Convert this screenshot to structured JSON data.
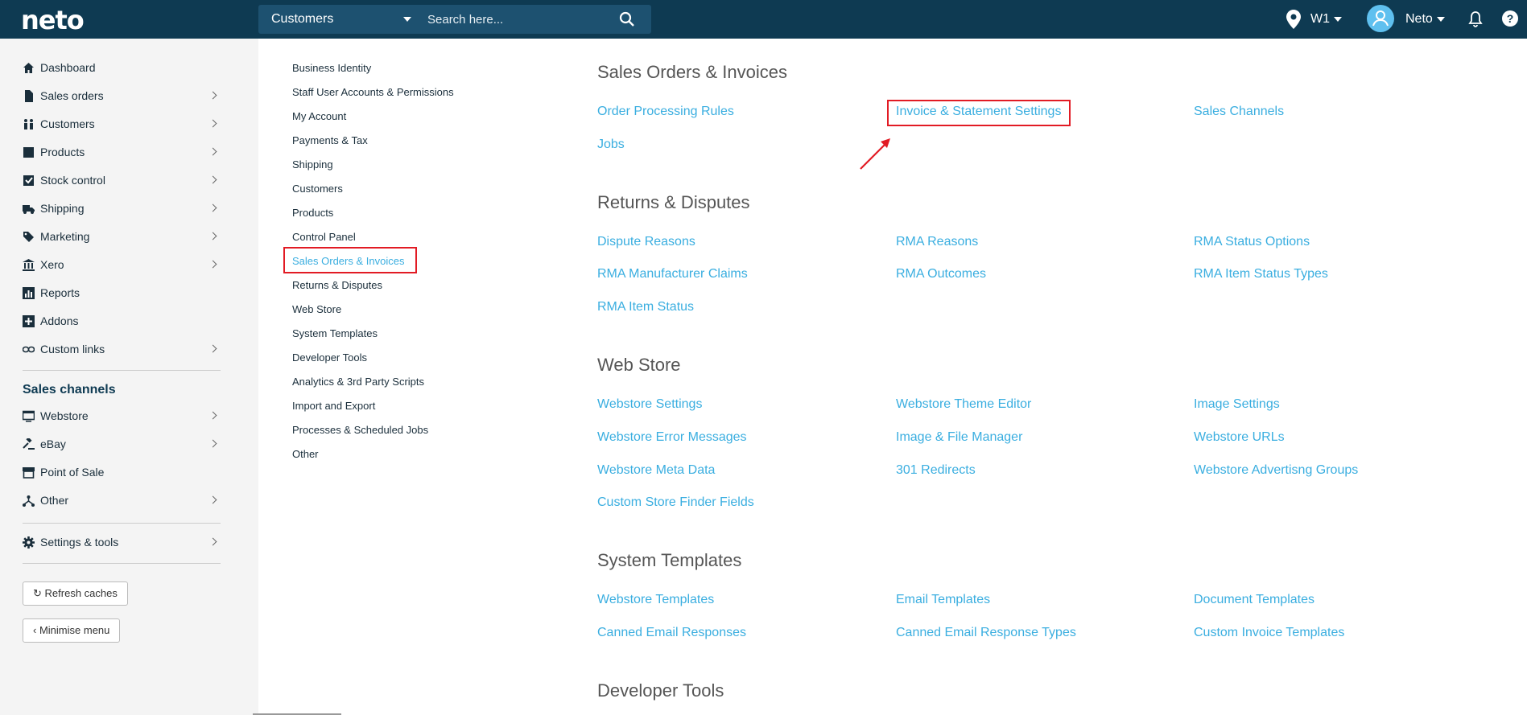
{
  "header": {
    "logo": "neto",
    "search_scope": "Customers",
    "search_placeholder": "Search here...",
    "location": "W1",
    "user": "Neto",
    "help": "?"
  },
  "sidebar": {
    "items": [
      {
        "label": "Dashboard",
        "icon": "home-icon"
      },
      {
        "label": "Sales orders",
        "icon": "document-icon"
      },
      {
        "label": "Customers",
        "icon": "people-icon"
      },
      {
        "label": "Products",
        "icon": "box-icon"
      },
      {
        "label": "Stock control",
        "icon": "checkbox-icon"
      },
      {
        "label": "Shipping",
        "icon": "truck-icon"
      },
      {
        "label": "Marketing",
        "icon": "tag-icon"
      },
      {
        "label": "Xero",
        "icon": "bank-icon"
      },
      {
        "label": "Reports",
        "icon": "chart-icon"
      },
      {
        "label": "Addons",
        "icon": "plus-icon"
      },
      {
        "label": "Custom links",
        "icon": "link-icon"
      }
    ],
    "channels_title": "Sales channels",
    "channels": [
      {
        "label": "Webstore",
        "icon": "monitor-icon"
      },
      {
        "label": "eBay",
        "icon": "gavel-icon"
      },
      {
        "label": "Point of Sale",
        "icon": "store-icon"
      },
      {
        "label": "Other",
        "icon": "network-icon"
      }
    ],
    "settings": "Settings & tools",
    "refresh_button": "Refresh caches",
    "minimise_button": "Minimise menu"
  },
  "settings_menu": [
    "Business Identity",
    "Staff User Accounts & Permissions",
    "My Account",
    "Payments & Tax",
    "Shipping",
    "Customers",
    "Products",
    "Control Panel",
    "Sales Orders & Invoices",
    "Returns & Disputes",
    "Web Store",
    "System Templates",
    "Developer Tools",
    "Analytics & 3rd Party Scripts",
    "Import and Export",
    "Processes & Scheduled Jobs",
    "Other"
  ],
  "groups": {
    "sales": {
      "title": "Sales Orders & Invoices",
      "links": [
        "Order Processing Rules",
        "Invoice & Statement Settings",
        "Sales Channels",
        "Jobs"
      ]
    },
    "returns": {
      "title": "Returns & Disputes",
      "links": [
        "Dispute Reasons",
        "RMA Reasons",
        "RMA Status Options",
        "RMA Manufacturer Claims",
        "RMA Outcomes",
        "RMA Item Status Types",
        "RMA Item Status"
      ]
    },
    "webstore": {
      "title": "Web Store",
      "links": [
        "Webstore Settings",
        "Webstore Theme Editor",
        "Image Settings",
        "Webstore Error Messages",
        "Image & File Manager",
        "Webstore URLs",
        "Webstore Meta Data",
        "301 Redirects",
        "Webstore Advertisng Groups",
        "Custom Store Finder Fields"
      ]
    },
    "templates": {
      "title": "System Templates",
      "links": [
        "Webstore Templates",
        "Email Templates",
        "Document Templates",
        "Canned Email Responses",
        "Canned Email Response Types",
        "Custom Invoice Templates"
      ]
    },
    "developer": {
      "title": "Developer Tools"
    }
  },
  "colors": {
    "topbar": "#0e3a52",
    "link": "#3aaee0",
    "highlight": "#e21b24"
  }
}
